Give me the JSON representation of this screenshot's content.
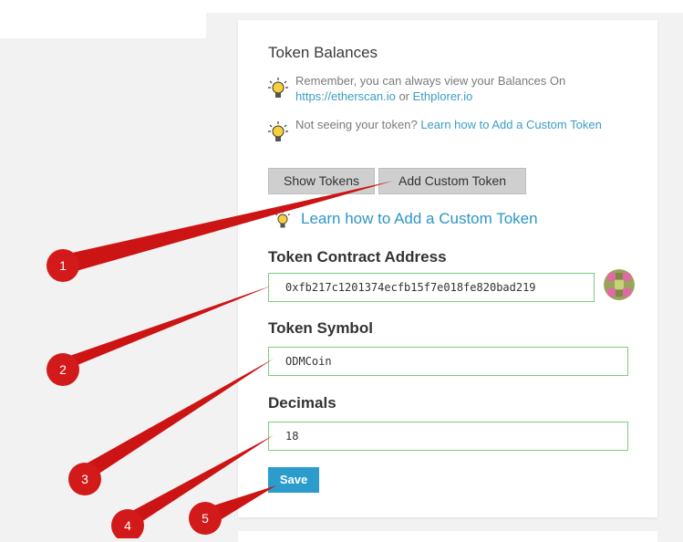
{
  "balances": {
    "title": "Token Balances",
    "tip1_text": "Remember, you can always view your Balances On",
    "tip1_link1": "https://etherscan.io",
    "tip1_or": " or ",
    "tip1_link2": "Ethplorer.io",
    "tip2_text": "Not seeing your token? ",
    "tip2_link": "Learn how to Add a Custom Token"
  },
  "buttons": {
    "show_tokens": "Show Tokens",
    "add_custom_token": "Add Custom Token",
    "save": "Save"
  },
  "learn_link": "Learn how to Add a Custom Token",
  "form": {
    "address_label": "Token Contract Address",
    "address_value": "0xfb217c1201374ecfb15f7e018fe820bad219",
    "symbol_label": "Token Symbol",
    "symbol_value": "ODMCoin",
    "decimals_label": "Decimals",
    "decimals_value": "18"
  },
  "annotations": {
    "badge_color": "#d21a1a",
    "labels": [
      "1",
      "2",
      "3",
      "4",
      "5"
    ]
  },
  "icons": [
    "lightbulb-icon",
    "identicon"
  ]
}
